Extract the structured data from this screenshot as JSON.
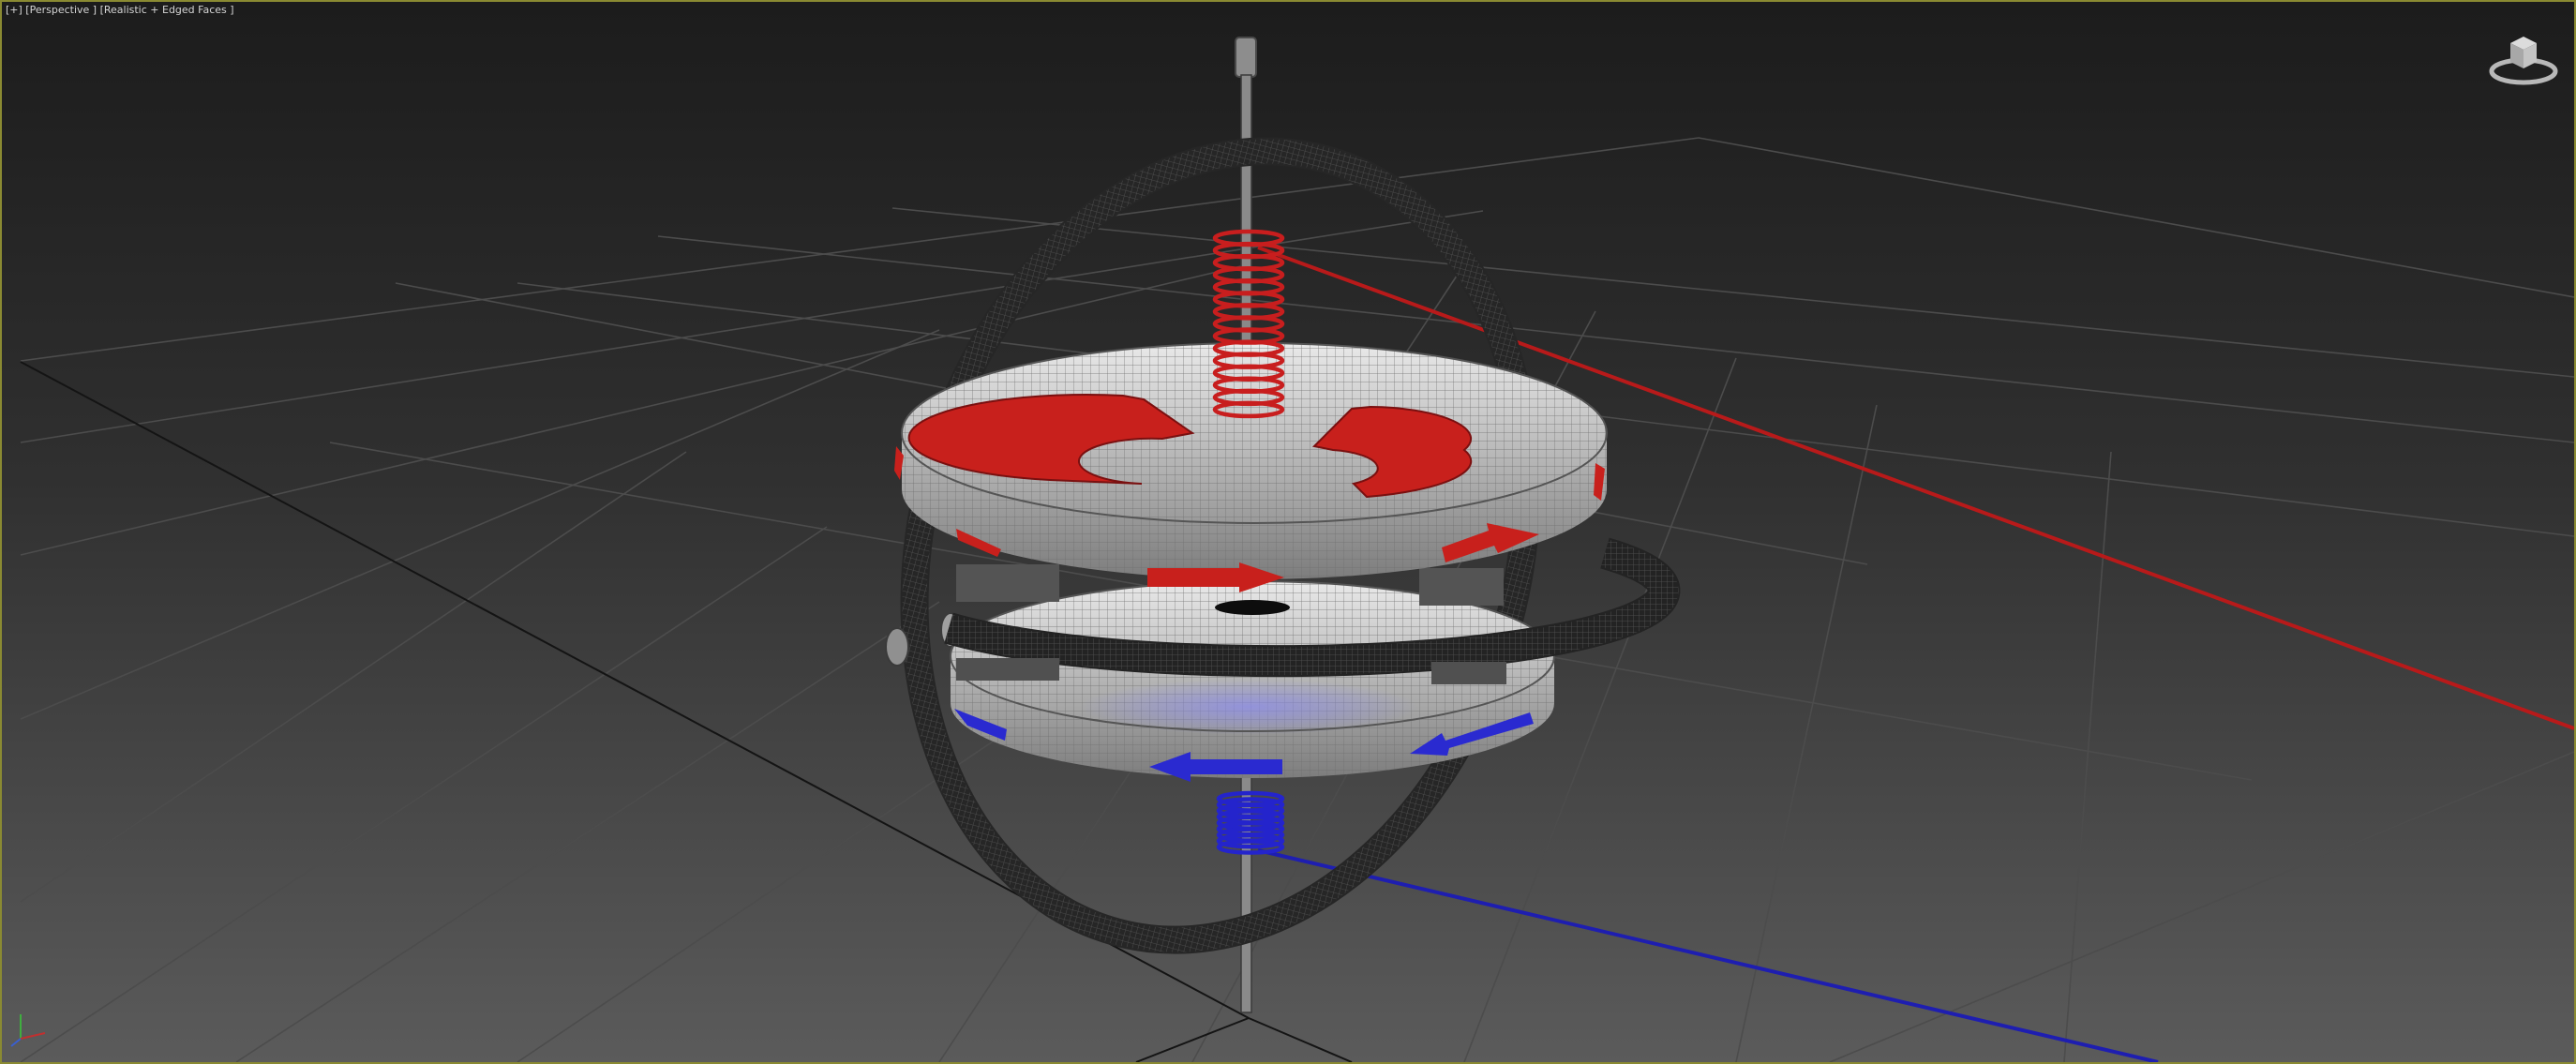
{
  "viewport": {
    "label": "[+] [Perspective ] [Realistic + Edged Faces ]",
    "view": "Perspective",
    "shading": "Realistic + Edged Faces",
    "border_color": "#8a8a32"
  },
  "scene": {
    "object": "gyroscope",
    "parts": [
      "outer-gimbal-ring",
      "inner-gimbal-ring",
      "upper-disc",
      "lower-disc",
      "upper-spring",
      "lower-spring",
      "axle"
    ],
    "accent_colors": {
      "positive": "#c8201c",
      "negative": "#2a2ac8",
      "rings": "#2a2a2a",
      "discs": "#d6d6d6"
    }
  },
  "icons": {
    "viewcube": "viewcube-icon",
    "axis": "axis-tripod-icon"
  }
}
